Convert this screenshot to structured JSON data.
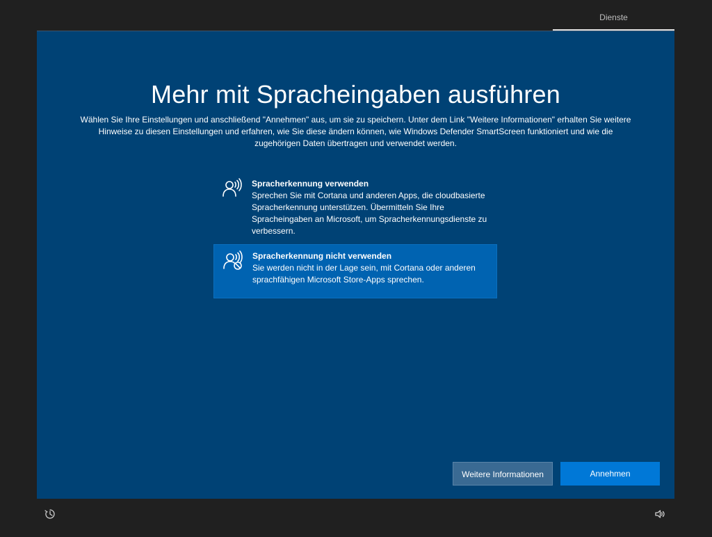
{
  "header": {
    "step_label": "Dienste"
  },
  "main": {
    "title": "Mehr mit Spracheingaben ausführen",
    "intro": "Wählen Sie Ihre Einstellungen und anschließend \"Annehmen\" aus, um sie zu speichern. Unter dem Link \"Weitere Informationen\" erhalten Sie weitere Hinweise zu diesen Einstellungen und erfahren, wie Sie diese ändern können, wie Windows Defender SmartScreen funktioniert und wie die zugehörigen Daten übertragen und verwendet werden.",
    "options": [
      {
        "title": "Spracherkennung verwenden",
        "description": "Sprechen Sie mit Cortana und anderen Apps, die cloudbasierte Spracherkennung unterstützen. Übermitteln Sie Ihre Spracheingaben an Microsoft, um Spracherkennungsdienste zu verbessern.",
        "icon": "speech-person-icon",
        "selected": false
      },
      {
        "title": "Spracherkennung nicht verwenden",
        "description": "Sie werden nicht in der Lage sein, mit Cortana oder anderen sprachfähigen Microsoft Store-Apps sprechen.",
        "icon": "speech-person-blocked-icon",
        "selected": true
      }
    ]
  },
  "buttons": {
    "more_info": "Weitere Informationen",
    "accept": "Annehmen"
  },
  "footer": {
    "left_icon": "ease-of-access-icon",
    "right_icon": "volume-icon"
  },
  "colors": {
    "panel_background": "#004275",
    "selected_option": "#0063b1",
    "accept_button": "#0078d7",
    "outer_background": "#202020"
  }
}
